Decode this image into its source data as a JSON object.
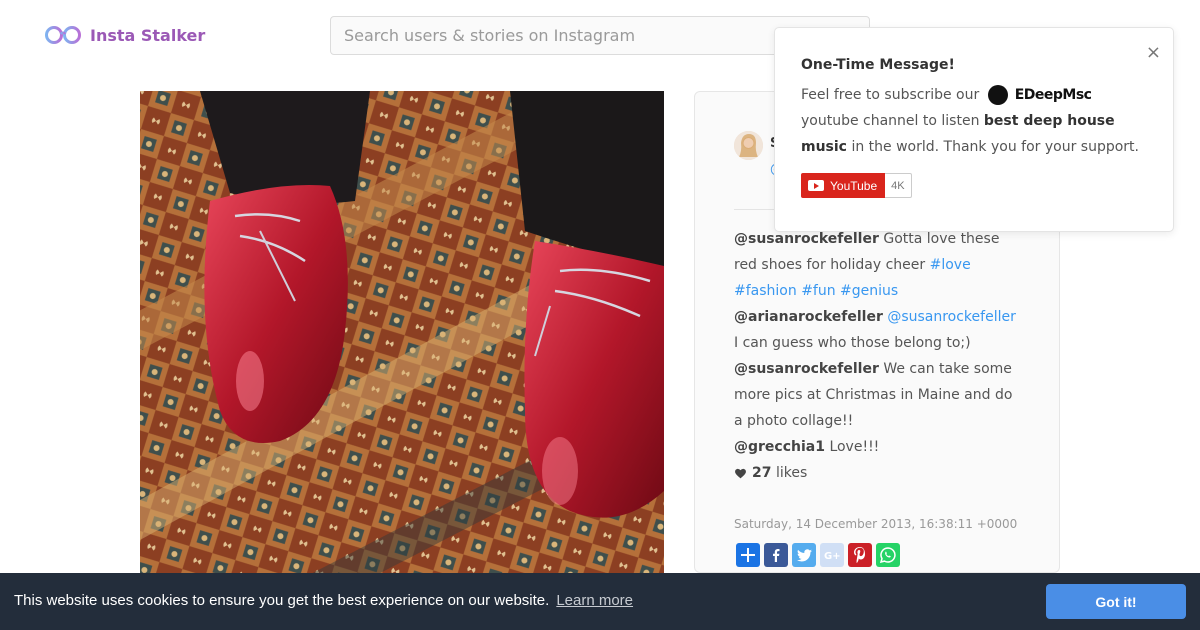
{
  "brand": {
    "name": "Insta Stalker",
    "color": "#9b59b6",
    "icon": "glasses-icon"
  },
  "search": {
    "placeholder": "Search users & stories on Instagram"
  },
  "post": {
    "user_partial": "S",
    "handle_partial": "@",
    "comments": [
      {
        "user": "@susanrockefeller",
        "text": "Gotta love these red shoes for holiday cheer",
        "tags": [
          "#love",
          "#fashion",
          "#fun",
          "#genius"
        ]
      },
      {
        "user": "@arianarockefeller",
        "mention": "@susanrockefeller",
        "text": "I can guess who those belong to;)"
      },
      {
        "user": "@susanrockefeller",
        "text": "We can take some more pics at Christmas in Maine and do a photo collage!!"
      },
      {
        "user": "@grecchia1",
        "text": "Love!!!"
      }
    ],
    "likes_count": "27",
    "likes_label": "likes",
    "date": "Saturday, 14 December 2013, 16:38:11 +0000",
    "share_buttons": [
      "share-icon",
      "facebook-icon",
      "twitter-icon",
      "google-plus-icon",
      "pinterest-icon",
      "whatsapp-icon"
    ]
  },
  "popup": {
    "title": "One-Time Message!",
    "text_before": "Feel free to subscribe our",
    "channel": "EDeepMsc",
    "text_after": "youtube channel to listen",
    "highlight": "best deep house music",
    "text_end": "in the world. Thank you for your support.",
    "close": "×",
    "youtube_label": "YouTube",
    "subscriber_count": "4K"
  },
  "cookie": {
    "text": "This website uses cookies to ensure you get the best experience on our website.",
    "link": "Learn more",
    "button": "Got it!"
  },
  "colors": {
    "link": "#3897f0",
    "cookie_bg": "#232d3b",
    "cookie_button": "#4a8ee6",
    "youtube_red": "#d9251c"
  }
}
